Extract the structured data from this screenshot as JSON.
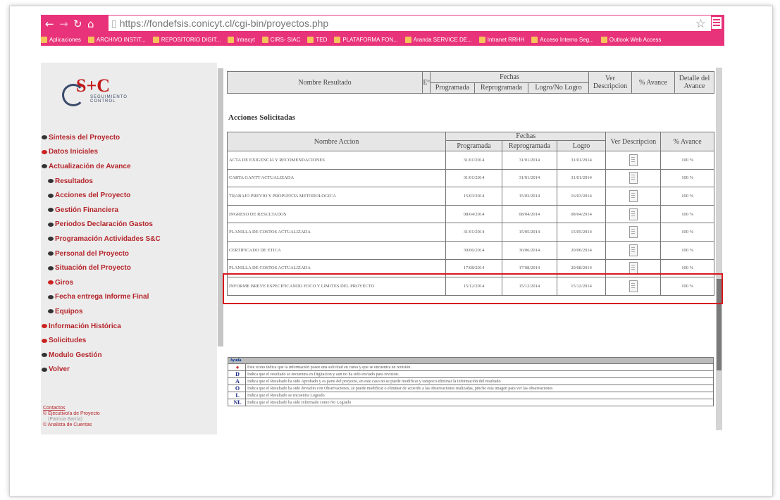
{
  "browser": {
    "url_host": "https://fondefsis.conicyt.cl",
    "url_path": "/cgi-bin/proyectos.php",
    "bookmarks": [
      "Aplicaciones",
      "ARCHIVO INSTIT...",
      "REPOSITORIO DIGIT...",
      "Intracyt",
      "CIRS- SIAC",
      "TED",
      "PLATAFORMA FON...",
      "Aranda SERVICE DE...",
      "Intranet RRHH",
      "Acceso Interno Seg...",
      "Outlook Web Access"
    ]
  },
  "logo": {
    "text": "S+C",
    "sub": "SEGUIMIENTO CONTROL"
  },
  "sidebar": {
    "items": [
      {
        "label": "Síntesis del Proyecto",
        "level": 0,
        "color": "dark"
      },
      {
        "label": "Datos Iniciales",
        "level": 0,
        "color": "red"
      },
      {
        "label": "Actualización de Avance",
        "level": 0,
        "color": "dark"
      },
      {
        "label": "Resultados",
        "level": 1,
        "color": "dark"
      },
      {
        "label": "Acciones del Proyecto",
        "level": 1,
        "color": "dark"
      },
      {
        "label": "Gestión Financiera",
        "level": 1,
        "color": "dark"
      },
      {
        "label": "Periodos Declaración Gastos",
        "level": 1,
        "color": "dark"
      },
      {
        "label": "Programación Actividades S&C",
        "level": 1,
        "color": "dark"
      },
      {
        "label": "Personal del Proyecto",
        "level": 1,
        "color": "dark"
      },
      {
        "label": "Situación del Proyecto",
        "level": 1,
        "color": "dark"
      },
      {
        "label": "Giros",
        "level": 1,
        "color": "red"
      },
      {
        "label": "Fecha entrega Informe Final",
        "level": 1,
        "color": "dark"
      },
      {
        "label": "Equipos",
        "level": 1,
        "color": "dark"
      },
      {
        "label": "Información Histórica",
        "level": 0,
        "color": "red"
      },
      {
        "label": "Solicitudes",
        "level": 0,
        "color": "red"
      },
      {
        "label": "Modulo Gestión",
        "level": 0,
        "color": "dark"
      },
      {
        "label": "Volver",
        "level": 0,
        "color": "dark"
      }
    ],
    "contacts_label": "Contactos",
    "contact1": "Ejecutivo/a de Proyecto",
    "contact1_name": "(Patricia Barría)",
    "contact2": "Analista de Cuentas"
  },
  "resultados_table": {
    "col_nombre": "Nombre Resultado",
    "col_e": "Eº",
    "col_fechas": "Fechas",
    "sub_programada": "Programada",
    "sub_reprogramada": "Reprogramada",
    "sub_logro": "Logro/No Logro",
    "col_ver": "Ver Descripcion",
    "col_avance": "% Avance",
    "col_detalle": "Detalle del Avance"
  },
  "acciones": {
    "title": "Acciones Solicitadas",
    "col_nombre": "Nombre Accion",
    "col_fechas": "Fechas",
    "sub_programada": "Programada",
    "sub_reprogramada": "Reprogramada",
    "sub_logro": "Logro",
    "col_ver": "Ver Descripcion",
    "col_avance": "% Avance",
    "rows": [
      {
        "name": "ACTA DE EXIGENCIA Y RECOMENDACIONES",
        "prog": "31/01/2014",
        "reprog": "31/01/2014",
        "logro": "31/01/2014",
        "avance": "100 %"
      },
      {
        "name": "CARTA GANTT ACTUALIZADA",
        "prog": "31/01/2014",
        "reprog": "31/01/2014",
        "logro": "31/01/2014",
        "avance": "100 %"
      },
      {
        "name": "TRABAJO PREVIO Y PROPUESTA METODOLOGICA",
        "prog": "15/03/2014",
        "reprog": "15/03/2014",
        "logro": "16/03/2014",
        "avance": "100 %"
      },
      {
        "name": "INGRESO DE RESULTADOS",
        "prog": "08/04/2014",
        "reprog": "08/04/2014",
        "logro": "08/04/2014",
        "avance": "100 %"
      },
      {
        "name": "PLANILLA DE COSTOS ACTUALIZADA",
        "prog": "31/01/2014",
        "reprog": "15/05/2014",
        "logro": "15/05/2014",
        "avance": "100 %"
      },
      {
        "name": "CERTIFICADO DE ETICA",
        "prog": "30/06/2014",
        "reprog": "30/06/2014",
        "logro": "20/06/2014",
        "avance": "100 %"
      },
      {
        "name": "PLANILLA DE COSTOS ACTUALIZADA",
        "prog": "17/08/2014",
        "reprog": "17/08/2014",
        "logro": "20/08/2014",
        "avance": "100 %"
      },
      {
        "name": "INFORME BREVE ESPECIFICANDO FOCO Y LIMITES DEL PROYECTO",
        "prog": "15/12/2014",
        "reprog": "15/12/2014",
        "logro": "15/12/2014",
        "avance": "100 %"
      }
    ]
  },
  "ayuda": {
    "title": "Ayuda",
    "rows": [
      {
        "code": "●",
        "text": "Este icono indica que la información posee una solicitud en curso y que se encuentra en revisión."
      },
      {
        "code": "D",
        "text": "Indica que el resultado se encuentra en Digitacion y aun no ha sido enviado para revision."
      },
      {
        "code": "A",
        "text": "Indica que el Resultado ha sido Aprobado y es parte del proyecto, en este caso no se puede modificar y tampoco eliminar la información del resultado"
      },
      {
        "code": "O",
        "text": "Indica que el Resultado ha sido devuelto con Observaciones, se puede modificar o eliminar de acuerdo a las observaciones realizadas, pinche esta imagen para ver las observaciones"
      },
      {
        "code": "L",
        "text": "Indica que el Resultado se encuentra Logrado"
      },
      {
        "code": "NL",
        "text": "Indica que el Resultado ha sido informado como No Logrado"
      }
    ]
  }
}
